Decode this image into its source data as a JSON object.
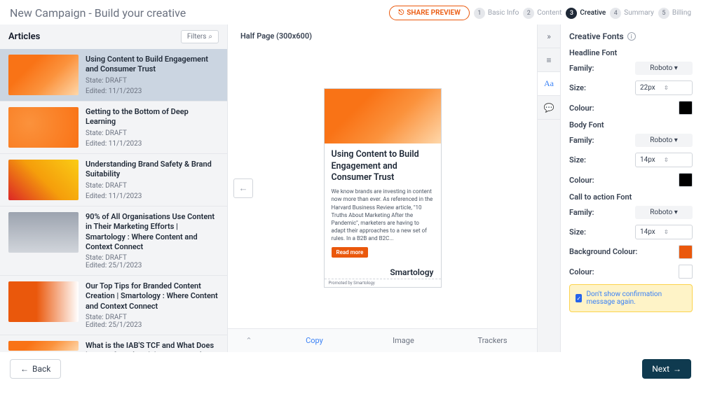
{
  "header": {
    "title": "New Campaign - Build your creative",
    "share": "SHARE PREVIEW",
    "steps": [
      {
        "num": "1",
        "label": "Basic Info"
      },
      {
        "num": "2",
        "label": "Content"
      },
      {
        "num": "3",
        "label": "Creative"
      },
      {
        "num": "4",
        "label": "Summary"
      },
      {
        "num": "5",
        "label": "Billing"
      }
    ]
  },
  "sidebar": {
    "title": "Articles",
    "filters": "Filters",
    "articles": [
      {
        "title": "Using Content to Build Engagement and Consumer Trust",
        "state": "State: DRAFT",
        "edited": "Edited: 11/1/2023"
      },
      {
        "title": "Getting to the Bottom of Deep Learning",
        "state": "State: DRAFT",
        "edited": "Edited: 11/1/2023"
      },
      {
        "title": "Understanding Brand Safety & Brand Suitability",
        "state": "State: DRAFT",
        "edited": "Edited: 11/1/2023"
      },
      {
        "title": "90% of All Organisations Use Content in Their Marketing Efforts | Smartology : Where Content and Context Connect",
        "state": "State: DRAFT",
        "edited": "Edited: 25/1/2023"
      },
      {
        "title": "Our Top Tips for Branded Content Creation | Smartology : Where Content and Context Connect",
        "state": "State: DRAFT",
        "edited": "Edited: 25/1/2023"
      },
      {
        "title": "What is the IAB'S TCF and What Does it Mean for Advertising? | Smartology : Where Content and",
        "state": "",
        "edited": ""
      }
    ]
  },
  "preview": {
    "size": "Half Page (300x600)",
    "ad": {
      "title": "Using Content to Build Engagement and Consumer Trust",
      "body": "We know brands are investing in content now more than ever. As referenced in the Harvard Business Review article, \"10 Truths About Marketing After the Pandemic\", marketers are having to adapt their approaches to a new set of rules. In a B2B and B2C...",
      "cta": "Read more",
      "logo": "Smartology",
      "promo_prefix": "Promoted by",
      "promo_brand": "Smartology"
    },
    "tabs": {
      "copy": "Copy",
      "image": "Image",
      "trackers": "Trackers"
    }
  },
  "props": {
    "panel_title": "Creative Fonts",
    "headline": {
      "title": "Headline Font",
      "family_label": "Family:",
      "family_value": "Roboto",
      "size_label": "Size:",
      "size_value": "22px",
      "colour_label": "Colour:"
    },
    "body": {
      "title": "Body Font",
      "family_label": "Family:",
      "family_value": "Roboto",
      "size_label": "Size:",
      "size_value": "14px",
      "colour_label": "Colour:"
    },
    "cta": {
      "title": "Call to action Font",
      "family_label": "Family:",
      "family_value": "Roboto",
      "size_label": "Size:",
      "size_value": "14px",
      "bg_label": "Background Colour:",
      "colour_label": "Colour:"
    },
    "notice": "Don't show confirmation message again."
  },
  "footer": {
    "back": "Back",
    "next": "Next"
  }
}
